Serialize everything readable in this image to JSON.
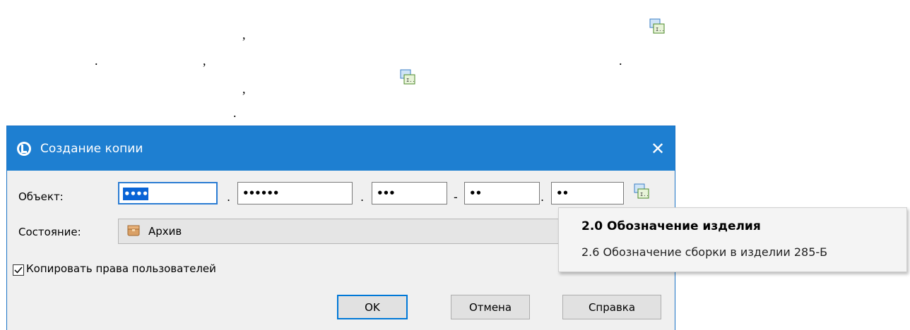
{
  "doc_fragments": [
    ",",
    ".",
    ",",
    ".",
    ",",
    "."
  ],
  "dialog": {
    "title": "Создание копии",
    "close_label": "✕",
    "object_label": "Объект:",
    "segments": [
      "••••",
      "••••••",
      "•••",
      "••",
      "••"
    ],
    "separators": [
      ".",
      ".",
      "-",
      "."
    ],
    "state_label": "Состояние:",
    "state_value": "Архив",
    "copy_rights_label": "Копировать права пользователей",
    "copy_rights_checked": true,
    "buttons": {
      "ok": "OK",
      "cancel": "Отмена",
      "help": "Справка"
    }
  },
  "popup": {
    "items": [
      "2.0 Обозначение изделия",
      "2.6 Обозначение сборки в изделии 285-Б"
    ]
  },
  "icons": {
    "picker": "designation-picker-icon",
    "app": "app-logo-icon",
    "archive": "archive-box-icon",
    "check": "check-icon"
  },
  "colors": {
    "titlebar": "#1e7fd1",
    "dialog_bg": "#f0f0f0",
    "selection": "#0a64d6",
    "focus_border": "#2a7cd3"
  }
}
